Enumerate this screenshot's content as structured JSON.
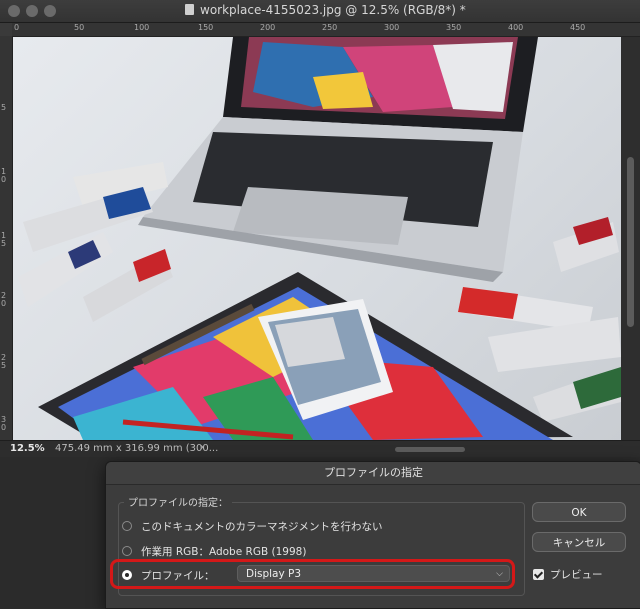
{
  "window": {
    "title": "workplace-4155023.jpg @ 12.5% (RGB/8*) *"
  },
  "ruler": {
    "top_ticks": [
      "0",
      "50",
      "100",
      "150",
      "200",
      "250",
      "300",
      "350",
      "400",
      "450"
    ],
    "left_ticks": [
      "5",
      "1 0",
      "1 5",
      "2 0",
      "2 5",
      "3 0"
    ]
  },
  "canvas": {
    "image_description_icon": "photo-canvas"
  },
  "status": {
    "zoom": "12.5%",
    "doc_info": "475.49 mm x 316.99 mm (300...",
    "arrow": "›"
  },
  "dialog": {
    "title": "プロファイルの指定",
    "group_label": "プロファイルの指定：",
    "options": [
      {
        "label": "このドキュメントのカラーマネジメントを行わない",
        "selected": false
      },
      {
        "label": "作業用 RGB：Adobe RGB (1998)",
        "selected": false
      },
      {
        "label": "プロファイル：",
        "selected": true
      }
    ],
    "profile_select": "Display P3",
    "ok_label": "OK",
    "cancel_label": "キャンセル",
    "preview_label": "プレビュー",
    "preview_checked": true
  }
}
